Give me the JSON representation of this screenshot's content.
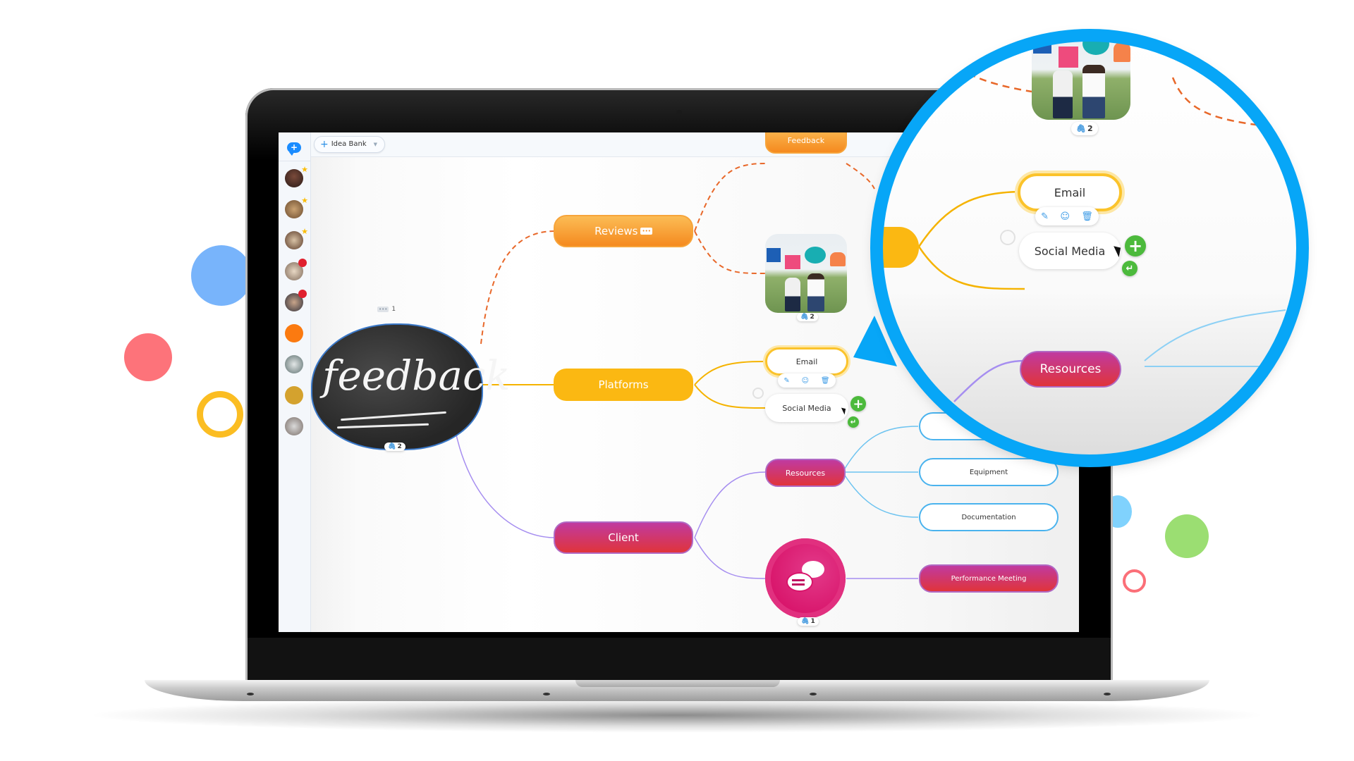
{
  "app": {
    "toolbar": {
      "idea_bank_label": "Idea Bank",
      "idea_bank_icon": "plus-icon"
    },
    "sidebar": {
      "new_chat_icon": "chat-add-icon",
      "items": [
        {
          "type": "avatar",
          "badge": "star"
        },
        {
          "type": "avatar",
          "badge": "star"
        },
        {
          "type": "avatar",
          "badge": "star"
        },
        {
          "type": "avatar",
          "badge": "notification-dot"
        },
        {
          "type": "avatar",
          "badge": "notification-dot"
        },
        {
          "type": "group",
          "badge": null
        },
        {
          "type": "avatar",
          "badge": null
        },
        {
          "type": "group",
          "badge": null
        },
        {
          "type": "avatar",
          "badge": null
        }
      ]
    }
  },
  "mindmap": {
    "root": {
      "label": "feedback",
      "comment_count": "1",
      "attachment_count": "2"
    },
    "branches": {
      "reviews": {
        "label": "Reviews",
        "icon": "comment-icon"
      },
      "platforms": {
        "label": "Platforms"
      },
      "client": {
        "label": "Client"
      }
    },
    "nodes": {
      "feedback": {
        "label": "Feedback"
      },
      "photo": {
        "attachment_count": "2"
      },
      "email": {
        "label": "Email"
      },
      "social_media": {
        "label": "Social Media"
      },
      "resources": {
        "label": "Resources"
      },
      "chat_node": {
        "attachment_count": "1"
      },
      "equipment": {
        "label": "Equipment"
      },
      "documentation": {
        "label": "Documentation"
      },
      "performance_meeting": {
        "label": "Performance Meeting"
      }
    },
    "node_toolbar": {
      "actions": [
        "edit",
        "add-emoji",
        "delete"
      ]
    },
    "quick_actions": [
      "add-child",
      "add-sibling"
    ]
  },
  "magnifier": {
    "email_label": "Email",
    "social_media_label": "Social Media",
    "resources_label": "Resources",
    "photo_attachment_count": "2"
  },
  "colors": {
    "magnifier_ring": "#07a6f7",
    "reviews_orange": "#f58a1f",
    "platforms_yellow": "#fbb812",
    "client_magenta": "#c03aa0",
    "link_blue": "#4ab3ee",
    "add_green": "#4cba3c"
  }
}
